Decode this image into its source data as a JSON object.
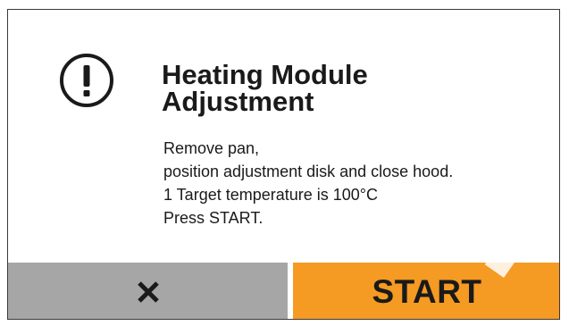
{
  "dialog": {
    "icon": "exclamation-circle-icon",
    "title_line1": "Heating Module",
    "title_line2": "Adjustment",
    "message_lines": [
      "Remove pan,",
      "position adjustment disk and close hood.",
      "1 Target temperature is 100°C",
      "Press START."
    ]
  },
  "buttons": {
    "cancel_icon": "close-x-icon",
    "start_label": "START"
  },
  "colors": {
    "start_button": "#f59a23",
    "cancel_button": "#a6a6a6",
    "text": "#1a1a1a"
  }
}
